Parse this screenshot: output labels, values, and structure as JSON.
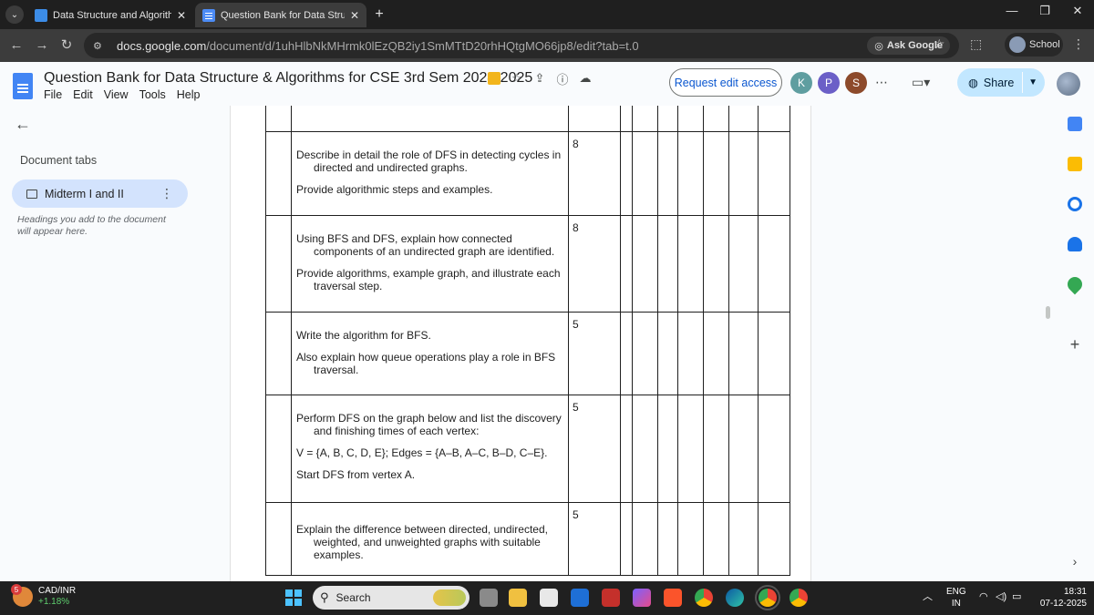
{
  "browser": {
    "tabs": [
      {
        "title": "Data Structure and Algorithms"
      },
      {
        "title": "Question Bank for Data Structur"
      }
    ],
    "url_host": "docs.google.com",
    "url_path": "/document/d/1uhHlbNkMHrmk0lEzQB2iy1SmMTtD20rhHQtgMO66jp8/edit?tab=t.0",
    "ask_google": "Ask Google",
    "profile": "School"
  },
  "docs": {
    "title": "Question Bank for Data Structure & Algorithms for CSE 3rd Sem 2024-2025",
    "menu": [
      "File",
      "Edit",
      "View",
      "Tools",
      "Help"
    ],
    "request_edit": "Request edit access",
    "collaborators": [
      {
        "initial": "K",
        "color": "#5f9ea0"
      },
      {
        "initial": "P",
        "color": "#6b5fc7"
      },
      {
        "initial": "S",
        "color": "#8d4a2b"
      }
    ],
    "share": "Share"
  },
  "sidebar": {
    "section_title": "Document tabs",
    "tab_label": "Midterm I and II",
    "hint": "Headings you add to the document will appear here."
  },
  "questions": [
    {
      "marks": "8",
      "lines": [
        "Describe in detail the role of DFS in detecting cycles in directed and undirected graphs.",
        "Provide algorithmic steps and examples."
      ]
    },
    {
      "marks": "8",
      "lines": [
        "Using BFS and DFS, explain how connected components of an undirected graph are identified.",
        "Provide algorithms, example graph, and illustrate each traversal step."
      ]
    },
    {
      "marks": "5",
      "lines": [
        "Write the algorithm for BFS.",
        "Also explain how queue operations play a role in BFS traversal."
      ]
    },
    {
      "marks": "5",
      "lines": [
        "Perform DFS on the graph below and list the discovery and finishing times of each vertex:",
        "V = {A, B, C, D, E}; Edges = {A–B, A–C, B–D, C–E}.",
        "Start DFS from vertex A."
      ]
    },
    {
      "marks": "5",
      "lines": [
        "Explain the difference between directed, undirected, weighted, and unweighted graphs with suitable examples."
      ]
    }
  ],
  "taskbar": {
    "weather_badge": "5",
    "ticker": "CAD/INR",
    "ticker_change": "+1.18%",
    "search_placeholder": "Search",
    "lang": "ENG",
    "region": "IN",
    "time": "18:31",
    "date": "07-12-2025"
  }
}
